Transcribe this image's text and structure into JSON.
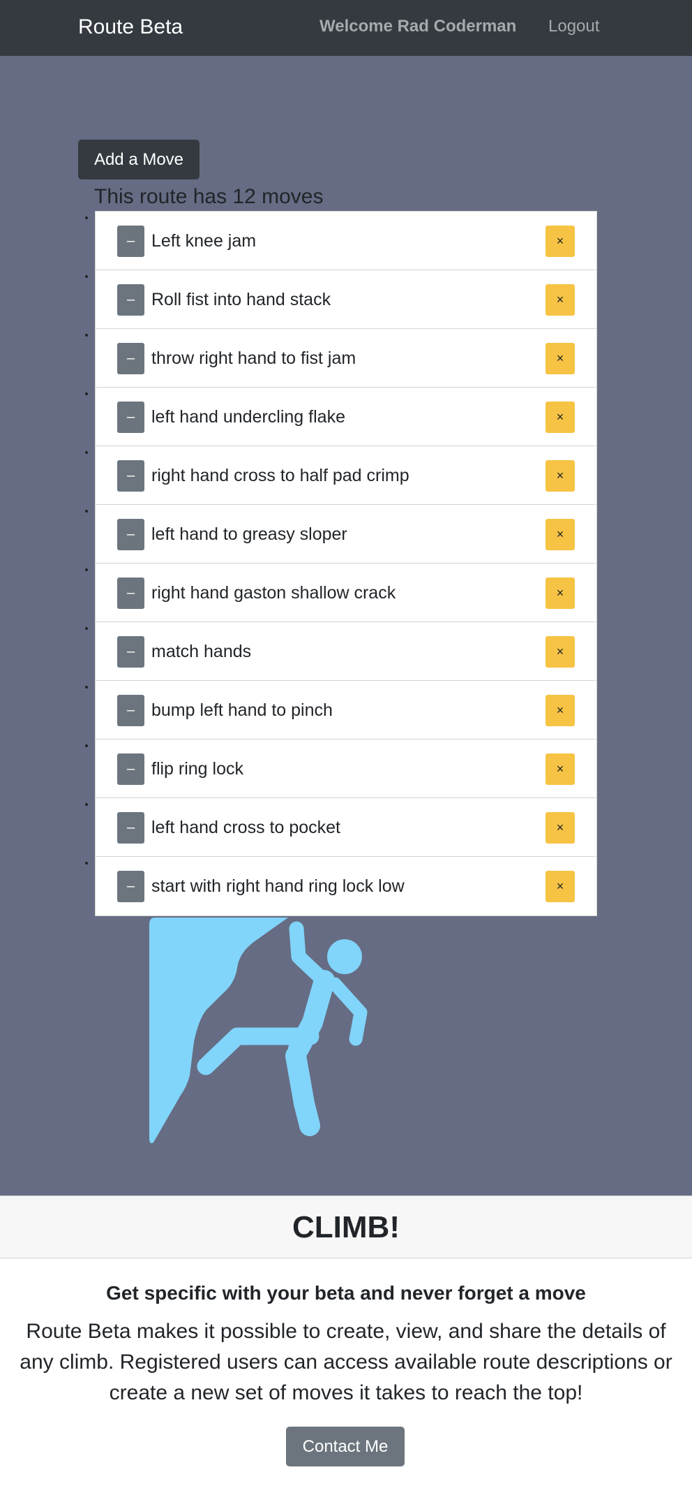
{
  "navbar": {
    "brand": "Route Beta",
    "welcome": "Welcome Rad Coderman",
    "logout": "Logout"
  },
  "add_move_label": "Add a Move",
  "route_count_text": "This route has 12 moves",
  "move_buttons": {
    "minus": "–",
    "remove": "×"
  },
  "moves": [
    "Left knee jam",
    "Roll fist into hand stack",
    "throw right hand to fist jam",
    "left hand undercling flake",
    "right hand cross to half pad crimp",
    "left hand to greasy sloper",
    "right hand gaston shallow crack",
    "match hands",
    "bump left hand to pinch",
    "flip ring lock",
    "left hand cross to pocket",
    "start with right hand ring lock low"
  ],
  "card": {
    "header": "CLIMB!",
    "title": "Get specific with your beta and never forget a move",
    "text": "Route Beta makes it possible to create, view, and share the details of any climb. Registered users can access available route descriptions or create a new set of moves it takes to reach the top!",
    "contact_label": "Contact Me"
  },
  "colors": {
    "page_bg": "#666c83",
    "navbar_bg": "#343a40",
    "climber": "#81d4fa",
    "remove_button": "#f6c344",
    "secondary_button": "#6c757d"
  },
  "icons": {
    "illustration": "rock-climber-icon"
  }
}
